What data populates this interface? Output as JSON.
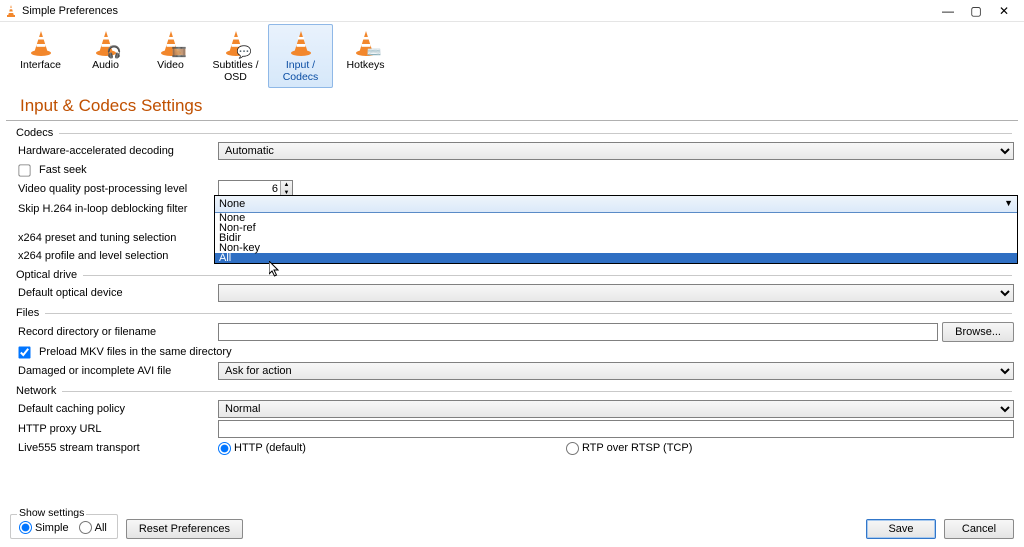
{
  "window": {
    "title": "Simple Preferences"
  },
  "categories": [
    {
      "id": "interface",
      "label": "Interface"
    },
    {
      "id": "audio",
      "label": "Audio"
    },
    {
      "id": "video",
      "label": "Video"
    },
    {
      "id": "subtitles",
      "label": "Subtitles / OSD"
    },
    {
      "id": "input",
      "label": "Input / Codecs",
      "selected": true
    },
    {
      "id": "hotkeys",
      "label": "Hotkeys"
    }
  ],
  "page_heading": "Input & Codecs Settings",
  "groups": {
    "codecs": "Codecs",
    "optical": "Optical drive",
    "files": "Files",
    "network": "Network"
  },
  "codecs": {
    "hw_decode_label": "Hardware-accelerated decoding",
    "hw_decode_value": "Automatic",
    "fast_seek_label": "Fast seek",
    "fast_seek_checked": false,
    "vq_label": "Video quality post-processing level",
    "vq_value": "6",
    "skip_label": "Skip H.264 in-loop deblocking filter",
    "skip_value": "None",
    "skip_options": [
      "None",
      "Non-ref",
      "Bidir",
      "Non-key",
      "All"
    ],
    "skip_hover_index": 4,
    "x264_preset_label": "x264 preset and tuning selection",
    "x264_profile_label": "x264 profile and level selection"
  },
  "optical": {
    "default_label": "Default optical device",
    "default_value": ""
  },
  "files": {
    "record_label": "Record directory or filename",
    "record_value": "",
    "browse": "Browse...",
    "preload_label": "Preload MKV files in the same directory",
    "preload_checked": true,
    "avi_label": "Damaged or incomplete AVI file",
    "avi_value": "Ask for action"
  },
  "network": {
    "cache_label": "Default caching policy",
    "cache_value": "Normal",
    "proxy_label": "HTTP proxy URL",
    "proxy_value": "",
    "live555_label": "Live555 stream transport",
    "radio_http": "HTTP (default)",
    "radio_rtsp": "RTP over RTSP (TCP)"
  },
  "footer": {
    "show_settings": "Show settings",
    "simple": "Simple",
    "all": "All",
    "reset": "Reset Preferences",
    "save": "Save",
    "cancel": "Cancel"
  }
}
